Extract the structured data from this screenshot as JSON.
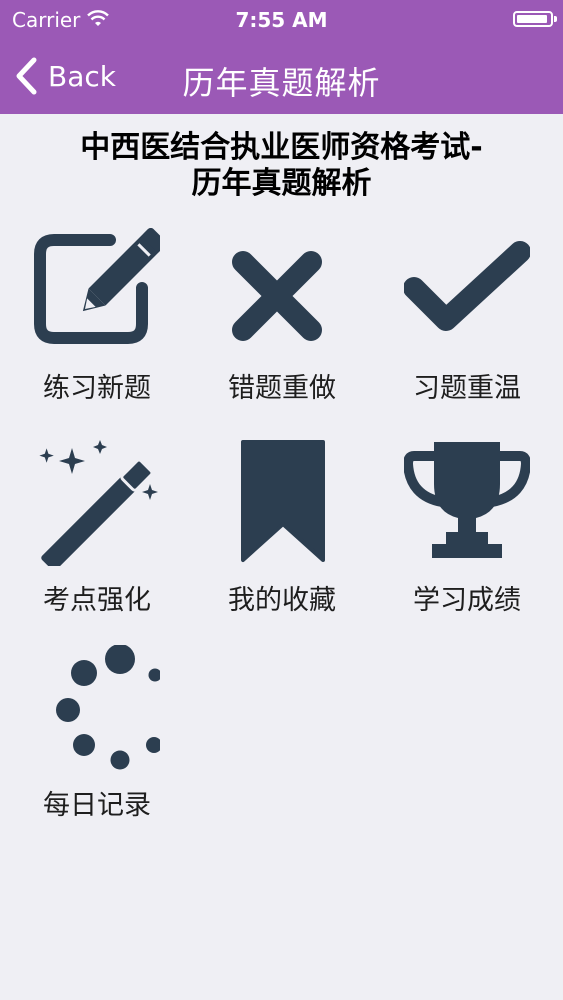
{
  "status_bar": {
    "carrier": "Carrier",
    "time": "7:55 AM",
    "battery_level": 0.95
  },
  "nav": {
    "back_label": "Back",
    "title": "历年真题解析"
  },
  "header": {
    "title_line1": "中西医结合执业医师资格考试-",
    "title_line2": "历年真题解析"
  },
  "icon_color": "#2c3e50",
  "accent_color": "#9b59b6",
  "tiles": [
    {
      "label": "练习新题",
      "icon": "edit-icon"
    },
    {
      "label": "错题重做",
      "icon": "close-icon"
    },
    {
      "label": "习题重温",
      "icon": "check-icon"
    },
    {
      "label": "考点强化",
      "icon": "magic-wand-icon"
    },
    {
      "label": "我的收藏",
      "icon": "bookmark-icon"
    },
    {
      "label": "学习成绩",
      "icon": "trophy-icon"
    },
    {
      "label": "每日记录",
      "icon": "spinner-icon"
    }
  ]
}
